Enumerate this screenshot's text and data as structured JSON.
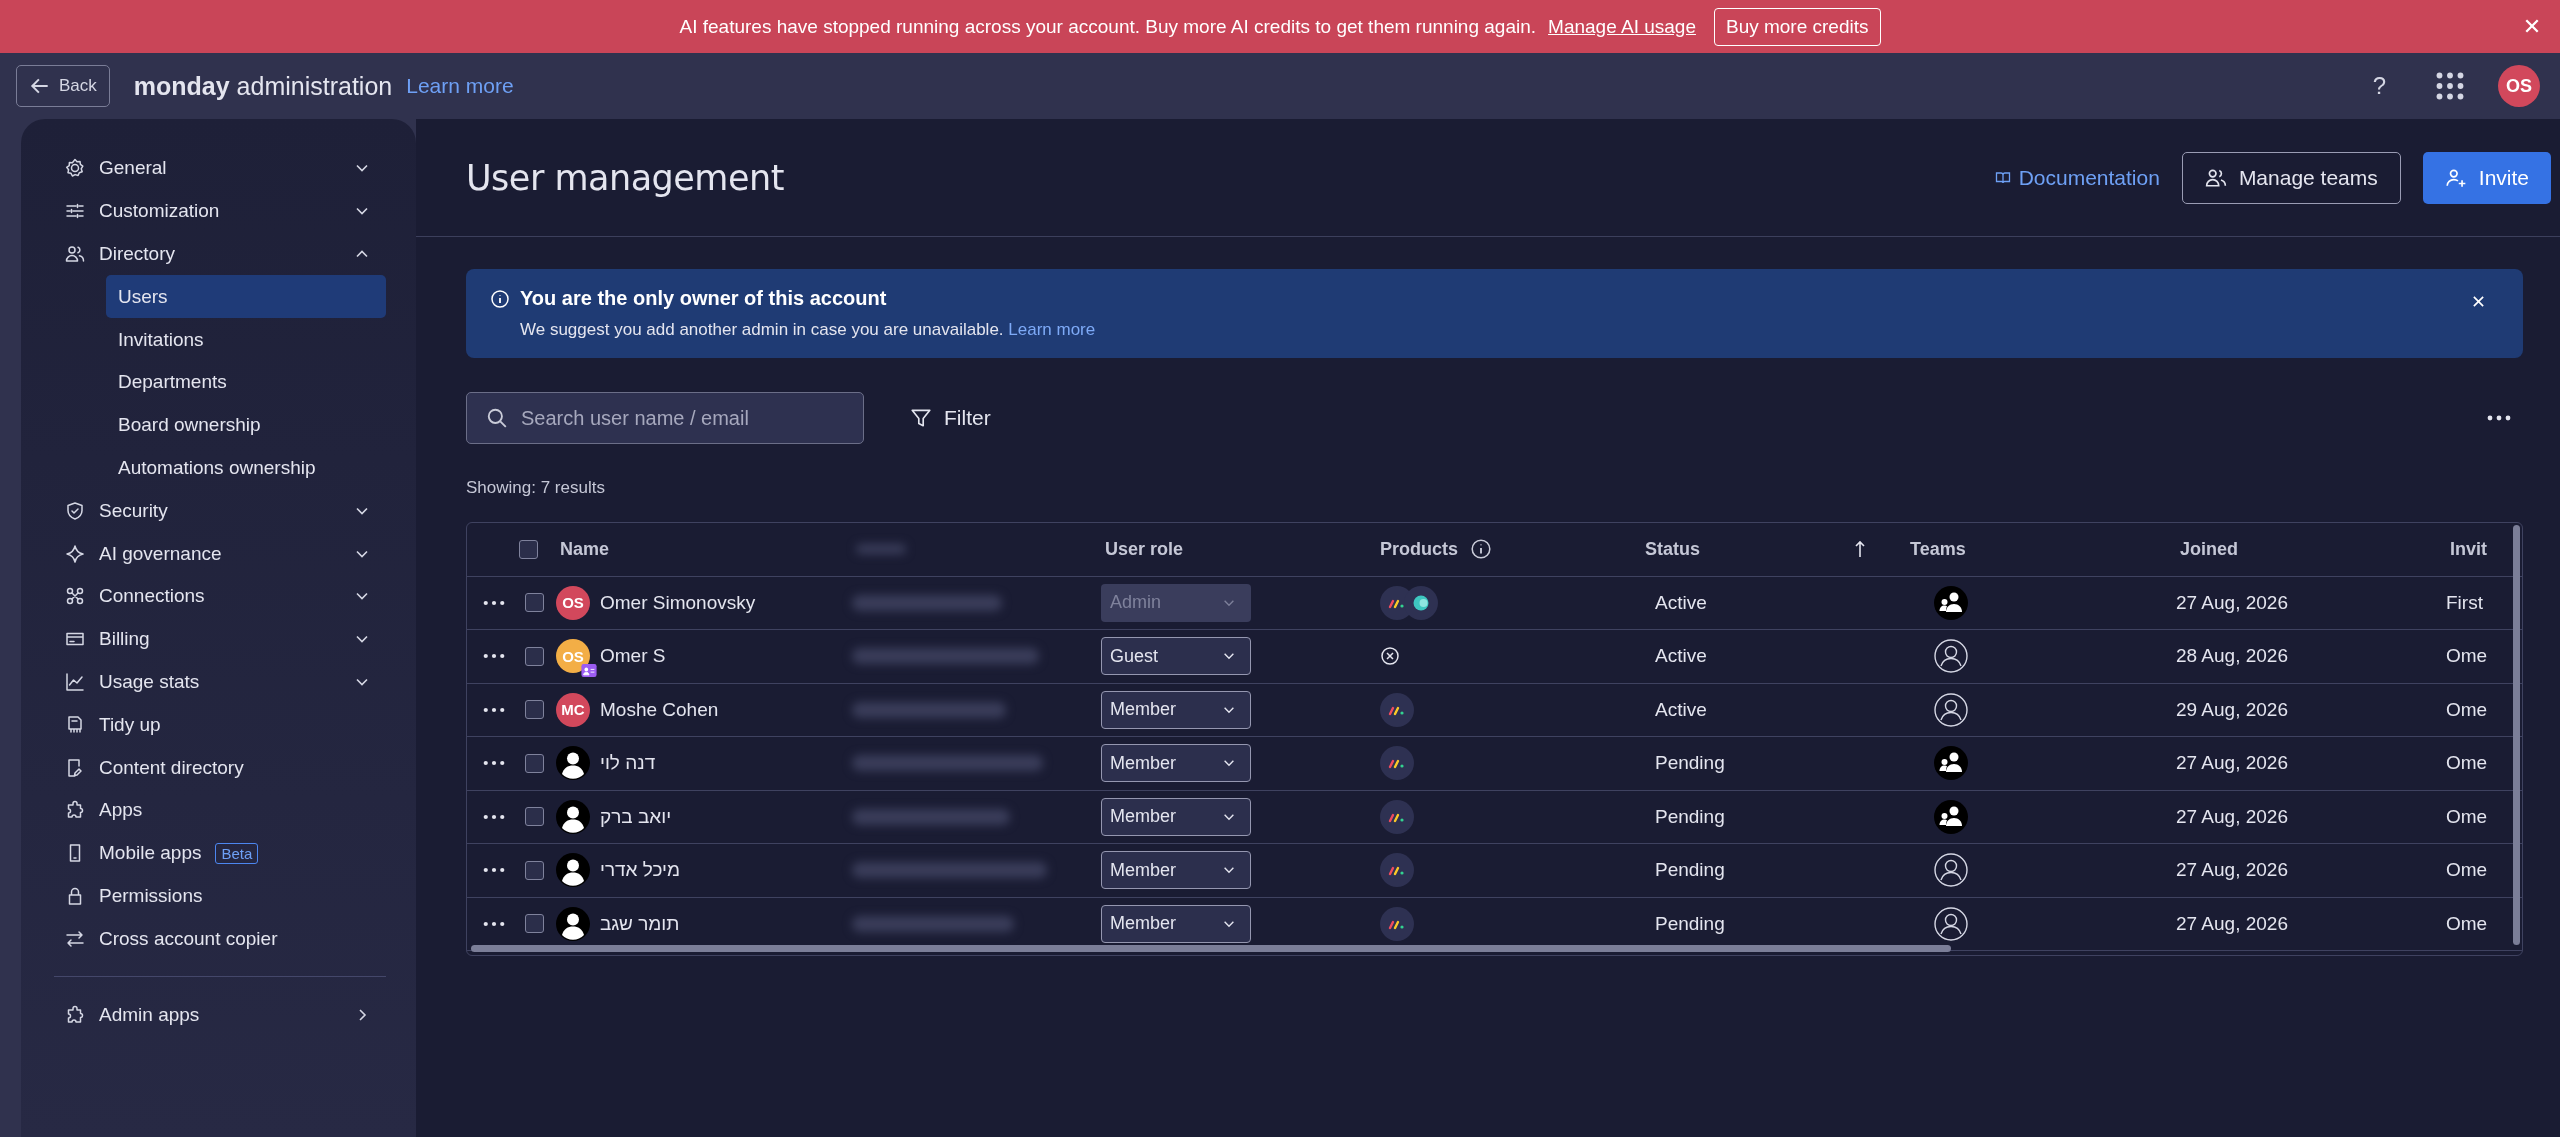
{
  "alert_banner": {
    "message": "AI features have stopped running across your account.  Buy more AI credits to get them running again.",
    "link": "Manage AI usage",
    "button": "Buy more credits"
  },
  "top_bar": {
    "back": "Back",
    "brand_bold": "monday",
    "brand_rest": "administration",
    "learn_more": "Learn more",
    "help": "?",
    "avatar": "OS"
  },
  "sidebar": {
    "items": [
      {
        "label": "General",
        "expanded": false
      },
      {
        "label": "Customization",
        "expanded": false
      },
      {
        "label": "Directory",
        "expanded": true,
        "children": [
          {
            "label": "Users",
            "selected": true
          },
          {
            "label": "Invitations",
            "selected": false
          },
          {
            "label": "Departments",
            "selected": false
          },
          {
            "label": "Board ownership",
            "selected": false
          },
          {
            "label": "Automations ownership",
            "selected": false
          }
        ]
      },
      {
        "label": "Security",
        "expanded": false
      },
      {
        "label": "AI governance",
        "expanded": false
      },
      {
        "label": "Connections",
        "expanded": false
      },
      {
        "label": "Billing",
        "expanded": false
      },
      {
        "label": "Usage stats",
        "expanded": false
      },
      {
        "label": "Tidy up"
      },
      {
        "label": "Content directory"
      },
      {
        "label": "Apps"
      },
      {
        "label": "Mobile apps",
        "badge": "Beta"
      },
      {
        "label": "Permissions"
      },
      {
        "label": "Cross account copier"
      }
    ],
    "footer_item": {
      "label": "Admin apps"
    }
  },
  "page": {
    "title": "User management",
    "documentation": "Documentation",
    "manage_teams": "Manage teams",
    "invite": "Invite"
  },
  "notice": {
    "title": "You are the only owner of this account",
    "text": "We suggest you add another admin in case you are unavailable.",
    "link": "Learn more"
  },
  "search": {
    "placeholder": "Search user name / email"
  },
  "filter": "Filter",
  "results": "Showing: 7 results",
  "table": {
    "all_selected": false,
    "columns": [
      {
        "kind": "text",
        "label": "Name",
        "sorted": false,
        "info": false
      },
      {
        "kind": "redacted"
      },
      {
        "kind": "text",
        "label": "User role",
        "sorted": false,
        "info": false
      },
      {
        "kind": "text",
        "label": "Products",
        "sorted": false,
        "info": true
      },
      {
        "kind": "text",
        "label": "Status",
        "sorted": true,
        "info": false
      },
      {
        "kind": "text",
        "label": "Teams",
        "sorted": false,
        "info": false
      },
      {
        "kind": "text",
        "label": "Joined",
        "sorted": false,
        "info": false
      },
      {
        "kind": "text",
        "label": "Invit",
        "info": false
      }
    ],
    "rows": [
      {
        "selected": false,
        "avatar": {
          "kind": "initials",
          "initials": "OS",
          "color": "#d2485c"
        },
        "guest": false,
        "name": "Omer Simonovsky",
        "email_redacted": true,
        "role": "Admin",
        "role_disabled": true,
        "product_access": true,
        "extra_product": true,
        "status": "Active",
        "has_team": true,
        "joined": "27 Aug, 2026",
        "invited": "First"
      },
      {
        "selected": false,
        "avatar": {
          "kind": "initials",
          "initials": "OS",
          "color": "#f3ae46"
        },
        "guest": true,
        "name": "Omer S",
        "email_redacted": true,
        "role": "Guest",
        "role_disabled": false,
        "product_access": false,
        "extra_product": false,
        "status": "Active",
        "has_team": false,
        "joined": "28 Aug, 2026",
        "invited": "Ome"
      },
      {
        "selected": false,
        "avatar": {
          "kind": "initials",
          "initials": "MC",
          "color": "#d2485c"
        },
        "guest": false,
        "name": "Moshe Cohen",
        "email_redacted": true,
        "role": "Member",
        "role_disabled": false,
        "product_access": true,
        "extra_product": false,
        "status": "Active",
        "has_team": false,
        "joined": "29 Aug, 2026",
        "invited": "Ome"
      },
      {
        "selected": false,
        "avatar": {
          "kind": "silhouette"
        },
        "guest": false,
        "name": "דנה לוי",
        "email_redacted": true,
        "role": "Member",
        "role_disabled": false,
        "product_access": true,
        "extra_product": false,
        "status": "Pending",
        "has_team": true,
        "joined": "27 Aug, 2026",
        "invited": "Ome"
      },
      {
        "selected": false,
        "avatar": {
          "kind": "silhouette"
        },
        "guest": false,
        "name": "יואב ברק",
        "email_redacted": true,
        "role": "Member",
        "role_disabled": false,
        "product_access": true,
        "extra_product": false,
        "status": "Pending",
        "has_team": true,
        "joined": "27 Aug, 2026",
        "invited": "Ome"
      },
      {
        "selected": false,
        "avatar": {
          "kind": "silhouette"
        },
        "guest": false,
        "name": "מיכל אדרי",
        "email_redacted": true,
        "role": "Member",
        "role_disabled": false,
        "product_access": true,
        "extra_product": false,
        "status": "Pending",
        "has_team": false,
        "joined": "27 Aug, 2026",
        "invited": "Ome"
      },
      {
        "selected": false,
        "avatar": {
          "kind": "silhouette"
        },
        "guest": false,
        "name": "תומר שגב",
        "email_redacted": true,
        "role": "Member",
        "role_disabled": false,
        "product_access": true,
        "extra_product": false,
        "status": "Pending",
        "has_team": false,
        "joined": "27 Aug, 2026",
        "invited": "Ome"
      }
    ]
  }
}
